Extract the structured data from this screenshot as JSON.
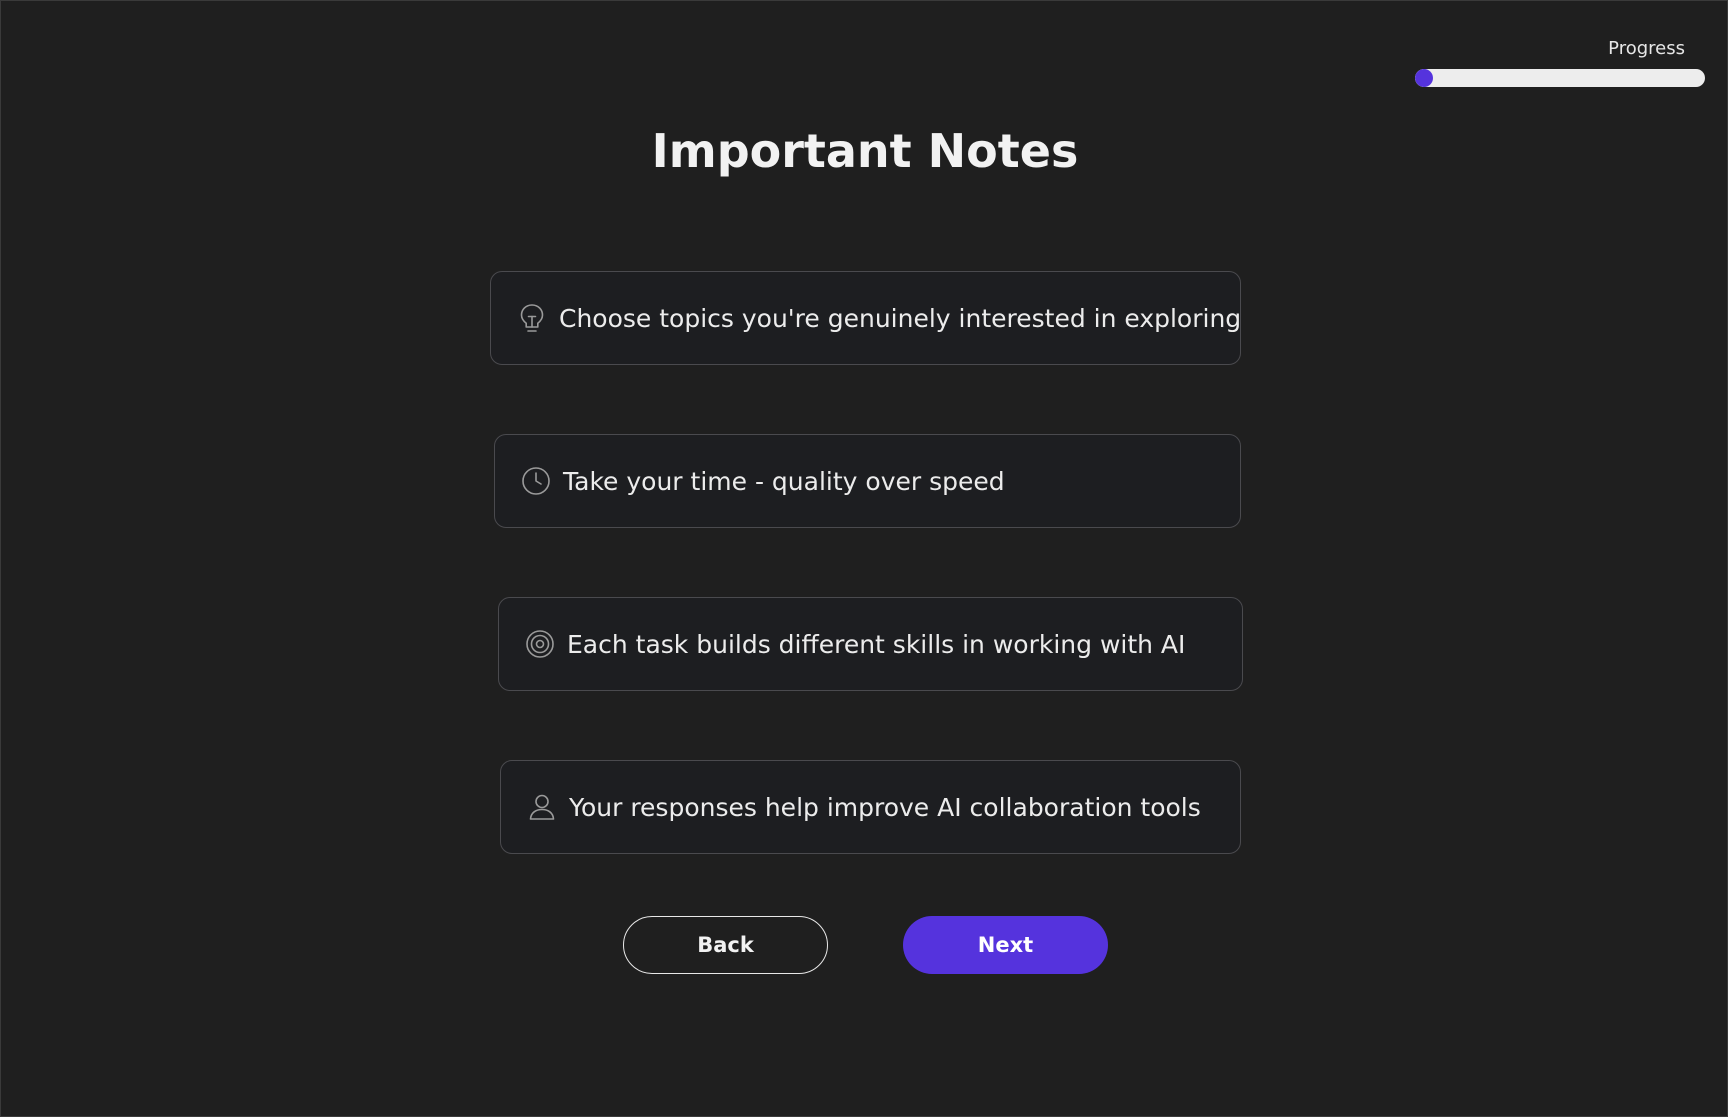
{
  "progress": {
    "label": "Progress",
    "value_percent": 3
  },
  "page": {
    "title": "Important Notes"
  },
  "notes": [
    {
      "icon": "lightbulb-icon",
      "text": "Choose topics you're genuinely interested in exploring"
    },
    {
      "icon": "clock-icon",
      "text": "Take your time - quality over speed"
    },
    {
      "icon": "target-icon",
      "text": "Each task builds different skills in working with AI"
    },
    {
      "icon": "user-icon",
      "text": "Your responses help improve AI collaboration tools"
    }
  ],
  "buttons": {
    "back_label": "Back",
    "next_label": "Next"
  },
  "colors": {
    "background": "#1f1f1f",
    "accent": "#5533dd",
    "card_border": "#4a4a4e"
  }
}
